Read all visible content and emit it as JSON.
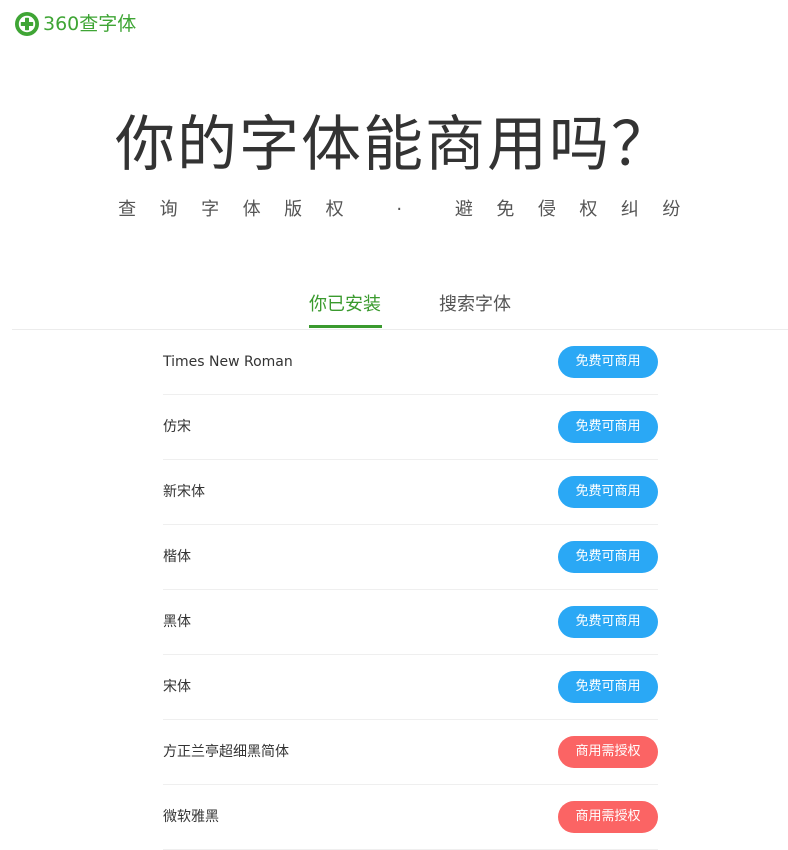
{
  "header": {
    "logo_text": "360查字体",
    "logo_color": "#3fa535"
  },
  "hero": {
    "title": "你的字体能商用吗？",
    "subtitle": "查询字体版权 · 避免侵权纠纷"
  },
  "tabs": [
    {
      "label": "你已安装",
      "active": true
    },
    {
      "label": "搜索字体",
      "active": false
    }
  ],
  "colors": {
    "accent_green": "#3a9a2e",
    "free_badge": "#2aa8f5",
    "license_badge": "#fb6464"
  },
  "fonts": [
    {
      "name": "Times New Roman",
      "status": "免费可商用",
      "status_type": "free"
    },
    {
      "name": "仿宋",
      "status": "免费可商用",
      "status_type": "free"
    },
    {
      "name": "新宋体",
      "status": "免费可商用",
      "status_type": "free"
    },
    {
      "name": "楷体",
      "status": "免费可商用",
      "status_type": "free"
    },
    {
      "name": "黑体",
      "status": "免费可商用",
      "status_type": "free"
    },
    {
      "name": "宋体",
      "status": "免费可商用",
      "status_type": "free"
    },
    {
      "name": "方正兰亭超细黑简体",
      "status": "商用需授权",
      "status_type": "license"
    },
    {
      "name": "微软雅黑",
      "status": "商用需授权",
      "status_type": "license"
    }
  ]
}
